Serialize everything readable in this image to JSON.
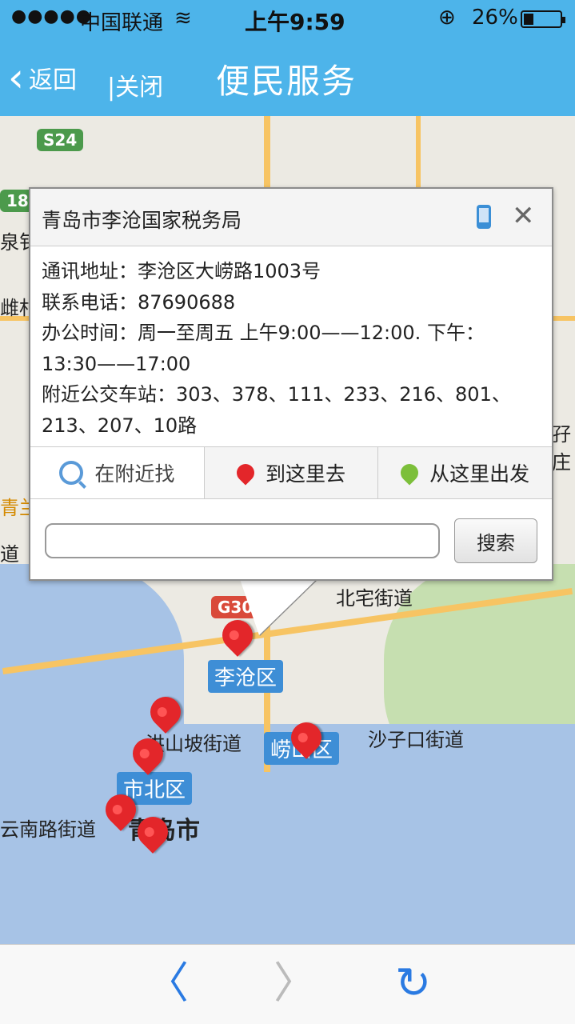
{
  "status": {
    "carrier": "中国联通",
    "time": "上午9:59",
    "battery": "26%"
  },
  "nav": {
    "back_label": "返回",
    "close_label": "|关闭",
    "title": "便民服务"
  },
  "map": {
    "labels": {
      "s24": "S24",
      "g18": "18",
      "quan": "泉钅",
      "village": "雌村",
      "south_label": "云南路街道",
      "qingdao": "青岛市",
      "dao": "道",
      "qinglan": "青兰",
      "beizhai": "北宅街道",
      "g308": "G308",
      "licang": "李沧区",
      "hongshanpo": "洪山坡街道",
      "laoshan": "崂山区",
      "shibei": "市北区",
      "shazikou": "沙子口街道",
      "right_edge": "孖庄"
    }
  },
  "popup": {
    "title": "青岛市李沧国家税务局",
    "address": "通讯地址：李沧区大崂路1003号",
    "phone": "联系电话：87690688",
    "hours_line1": "办公时间：周一至周五 上午9:00——12:00. 下午：",
    "hours_line2": "13:30——17:00",
    "bus_line1": "附近公交车站：303、378、111、233、216、801、",
    "bus_line2": "213、207、10路",
    "tabs": [
      "在附近找",
      "到这里去",
      "从这里出发"
    ],
    "search_placeholder": "",
    "search_button": "搜索"
  },
  "bottom": {
    "back": "〈",
    "forward": "〉",
    "reload": "↻"
  }
}
